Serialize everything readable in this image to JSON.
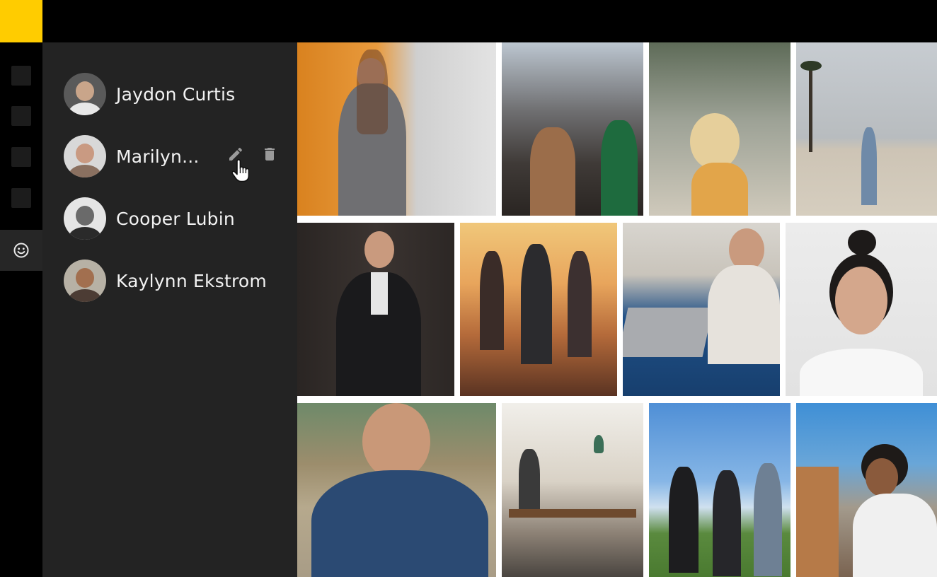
{
  "brand": {
    "color": "#ffcc00"
  },
  "rail": {
    "items": [
      {
        "icon": "square-icon"
      },
      {
        "icon": "square-icon"
      },
      {
        "icon": "square-icon"
      },
      {
        "icon": "square-icon"
      },
      {
        "icon": "smiley-icon",
        "active": true
      }
    ]
  },
  "people": [
    {
      "name": "Jaydon Curtis"
    },
    {
      "name": "Marilyn...",
      "hovered": true
    },
    {
      "name": "Cooper Lubin"
    },
    {
      "name": "Kaylynn Ekstrom"
    }
  ],
  "hover_actions": {
    "edit_icon": "pencil-icon",
    "delete_icon": "trash-icon"
  },
  "photos": [
    "photo-woman-grey-blazer",
    "photo-city-crosswalk",
    "photo-blonde-woman-sunlight",
    "photo-man-beach-palm",
    "photo-man-suit",
    "photo-friends-sunset",
    "photo-laptop-picnic",
    "photo-woman-hair-bun",
    "photo-smiling-man-patterned-shirt",
    "photo-cafe-interior",
    "photo-friends-heart-hands",
    "photo-woman-curly-hair-city"
  ]
}
